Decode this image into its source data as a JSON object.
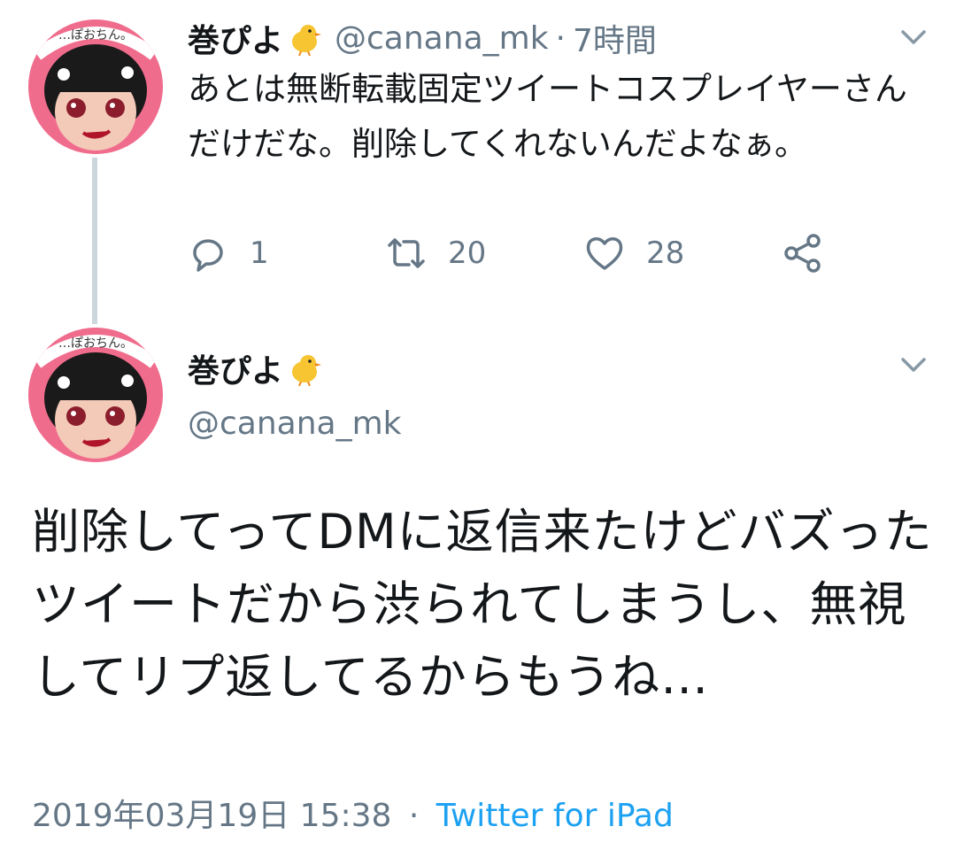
{
  "tweet1": {
    "display_name": "巻ぴよ",
    "handle": "@canana_mk",
    "separator": "·",
    "time": "7時間",
    "text": "あとは無断転載固定ツイートコスプレイヤーさんだけだな。削除してくれないんだよなぁ。",
    "reply_count": "1",
    "retweet_count": "20",
    "like_count": "28",
    "icons": [
      "reply-icon",
      "retweet-icon",
      "like-icon",
      "share-icon",
      "chevron-down-icon"
    ]
  },
  "tweet2": {
    "display_name": "巻ぴよ",
    "handle": "@canana_mk",
    "text": "削除してってDMに返信来たけどバズったツイートだから渋られてしまうし、無視してリプ返してるからもうね…",
    "timestamp": "2019年03月19日 15:38",
    "separator": "·",
    "source": "Twitter for iPad"
  },
  "avatar_text": "…ぽおちん。",
  "colors": {
    "text": "#14171a",
    "secondary": "#657786",
    "link": "#1da1f2",
    "thread_line": "#ccd6dd",
    "avatar_bg": "#f06c8d"
  }
}
